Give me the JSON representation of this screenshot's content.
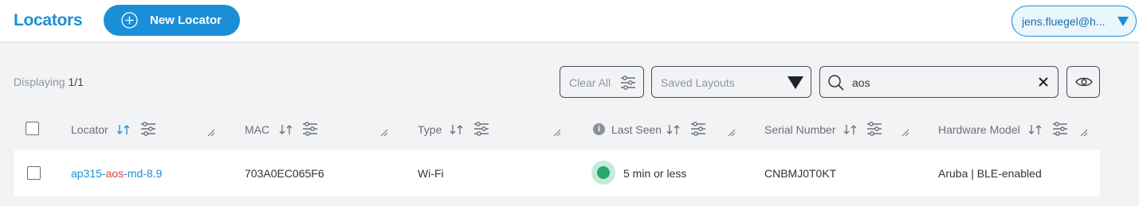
{
  "header": {
    "title": "Locators",
    "new_button_label": "New Locator",
    "user_label": "jens.fluegel@h..."
  },
  "toolbar": {
    "displaying_label": "Displaying",
    "displaying_count": "1/1",
    "clear_all_label": "Clear All",
    "saved_layouts_placeholder": "Saved Layouts",
    "search_value": "aos"
  },
  "table": {
    "columns": [
      "Locator",
      "MAC",
      "Type",
      "Last Seen",
      "Serial Number",
      "Hardware Model"
    ],
    "rows": [
      {
        "locator_prefix": "ap315-",
        "locator_match": "aos",
        "locator_suffix": "-md-8.9",
        "mac": "703A0EC065F6",
        "type": "Wi-Fi",
        "last_seen": "5 min or less",
        "serial": "CNBMJ0T0KT",
        "hardware_model": "Aruba | BLE-enabled"
      }
    ]
  },
  "colors": {
    "accent": "#1a8fd8",
    "status_online": "#27a86b",
    "search_highlight": "#d64545"
  },
  "icons": [
    "plus-circle-icon",
    "caret-down-icon",
    "filter-sliders-icon",
    "search-icon",
    "close-icon",
    "eye-icon",
    "sort-arrows-icon",
    "resize-handle-icon",
    "info-icon",
    "status-dot-icon"
  ]
}
